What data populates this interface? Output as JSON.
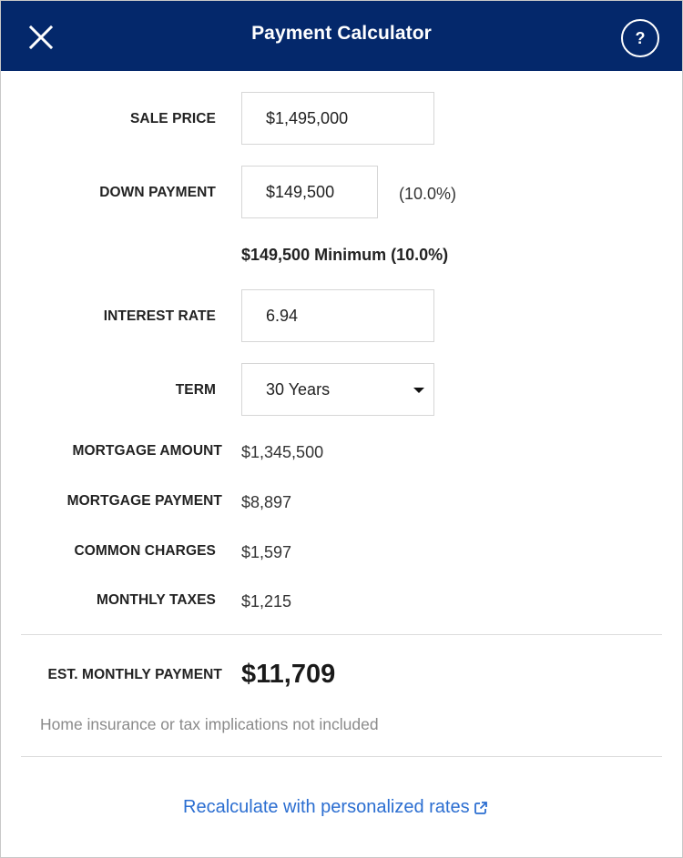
{
  "header": {
    "title": "Payment Calculator",
    "help_label": "?"
  },
  "form": {
    "sale_price": {
      "label": "SALE PRICE",
      "value": "$1,495,000"
    },
    "down_payment": {
      "label": "DOWN PAYMENT",
      "value": "$149,500",
      "percent": "(10.0%)"
    },
    "minimum_note": "$149,500 Minimum (10.0%)",
    "interest_rate": {
      "label": "INTEREST RATE",
      "value": "6.94"
    },
    "term": {
      "label": "TERM",
      "value": "30 Years"
    }
  },
  "breakdown": {
    "mortgage_amount": {
      "label": "MORTGAGE AMOUNT",
      "value": "$1,345,500"
    },
    "mortgage_payment": {
      "label": "MORTGAGE PAYMENT",
      "value": "$8,897"
    },
    "common_charges": {
      "label": "COMMON CHARGES",
      "value": "$1,597"
    },
    "monthly_taxes": {
      "label": "MONTHLY TAXES",
      "value": "$1,215"
    }
  },
  "total": {
    "label": "EST. MONTHLY PAYMENT",
    "value": "$11,709",
    "note": "Home insurance or tax implications not included"
  },
  "footer": {
    "link_label": "Recalculate with personalized rates"
  },
  "icons": {
    "close": "close-icon",
    "help": "question-icon",
    "external": "external-link-icon",
    "caret": "caret-down-icon"
  },
  "colors": {
    "header_bg": "#04286b",
    "link": "#2b6ed1",
    "note": "#8a8a8a"
  }
}
